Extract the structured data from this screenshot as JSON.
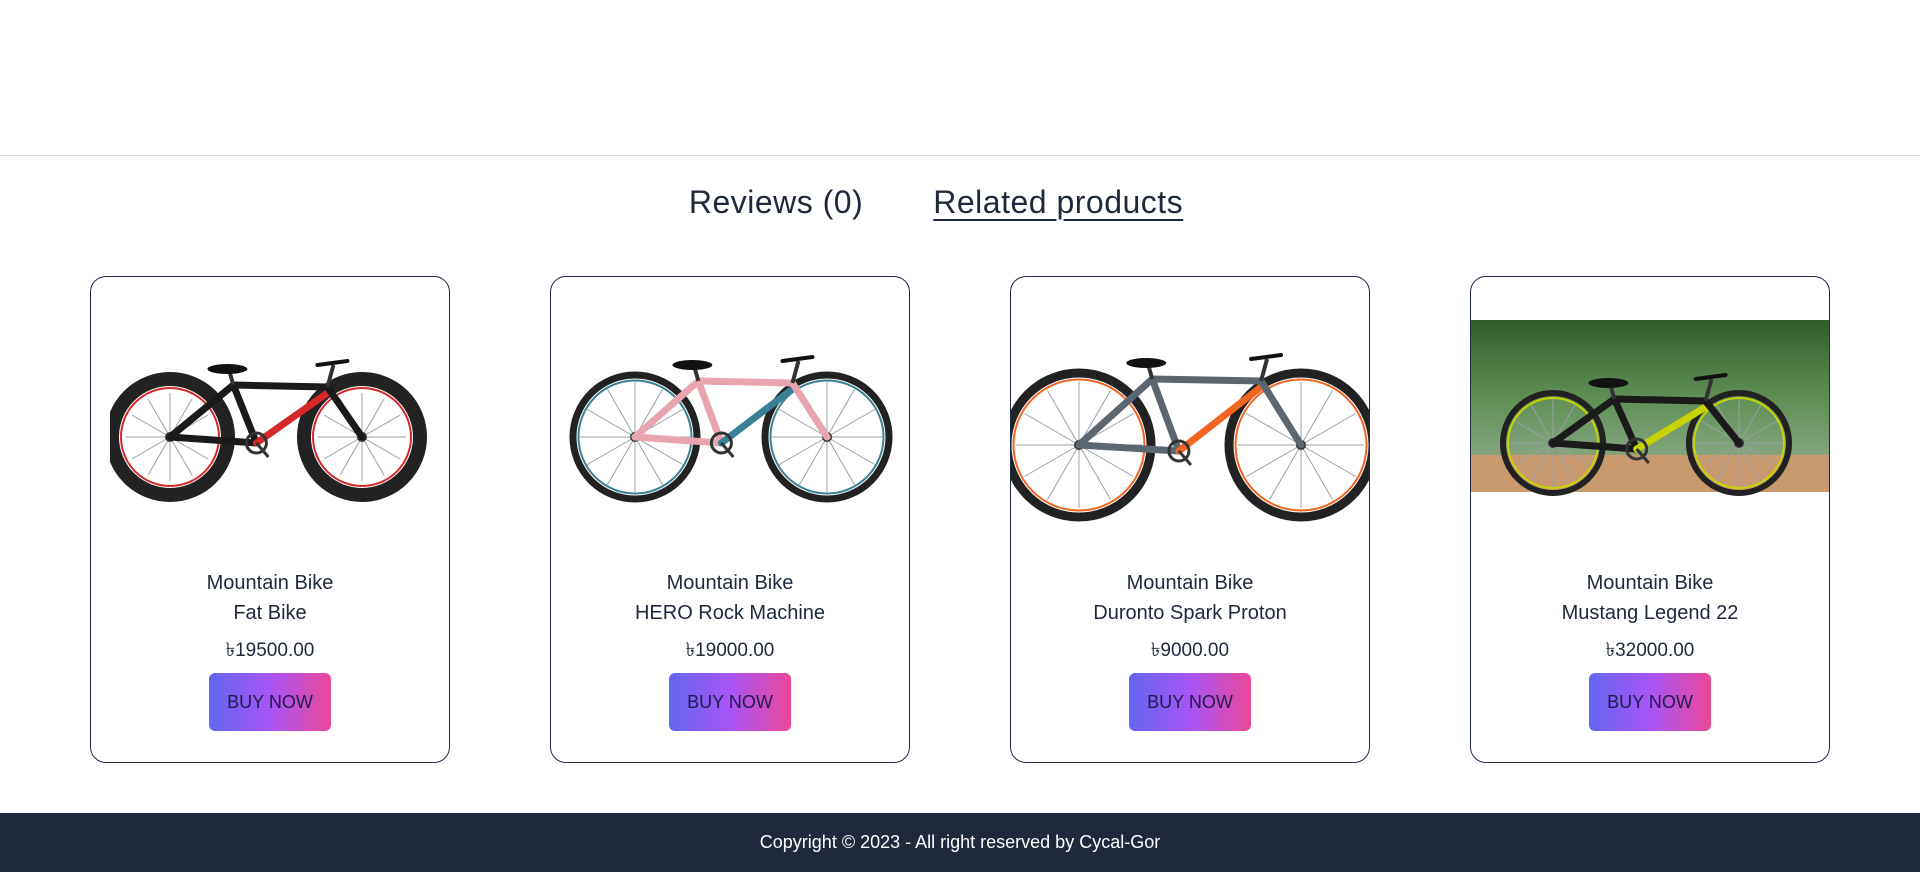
{
  "tabs": {
    "reviews_label": "Reviews (0)",
    "related_label": "Related products"
  },
  "products": [
    {
      "category": "Mountain Bike",
      "model": "Fat Bike",
      "price": "৳19500.00",
      "button": "BUY NOW",
      "image_icon": "fat-bike-image",
      "frame_color": "#1a1a1a",
      "accent_color": "#d62828"
    },
    {
      "category": "Mountain Bike",
      "model": "HERO Rock Machine",
      "price": "৳19000.00",
      "button": "BUY NOW",
      "image_icon": "hero-rock-machine-image",
      "frame_color": "#e8a5b0",
      "accent_color": "#3b7f95"
    },
    {
      "category": "Mountain Bike",
      "model": "Duronto Spark Proton",
      "price": "৳9000.00",
      "button": "BUY NOW",
      "image_icon": "duronto-spark-proton-image",
      "frame_color": "#5b6670",
      "accent_color": "#f26522"
    },
    {
      "category": "Mountain Bike",
      "model": "Mustang Legend 22",
      "price": "৳32000.00",
      "button": "BUY NOW",
      "image_icon": "mustang-legend-22-image",
      "frame_color": "#1a1a1a",
      "accent_color": "#c8d400"
    }
  ],
  "footer": {
    "copyright": "Copyright © 2023 - All right reserved by Cycal-Gor"
  },
  "colors": {
    "text": "#1e293b",
    "footer_bg": "#1e293b",
    "card_border": "#1e2a4a",
    "button_gradient_start": "#6366f1",
    "button_gradient_mid": "#a855f7",
    "button_gradient_end": "#ec4899"
  }
}
